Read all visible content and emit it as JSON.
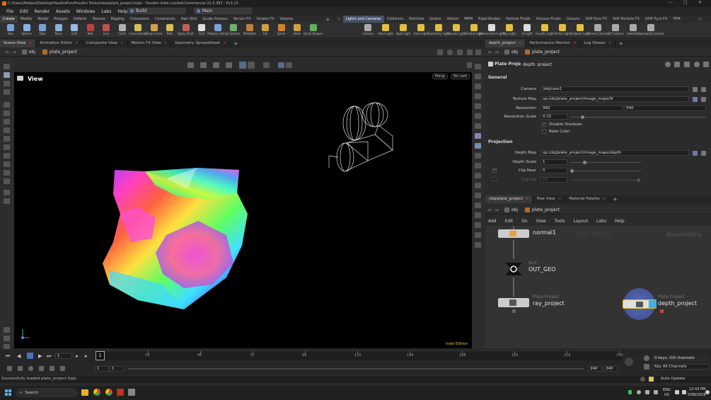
{
  "window": {
    "title": "C:/Users/Hallam/Desktop/HoudiniFun/Houdini Tricks/hdas/plate_project.hiplc - Houdini Indie Limited-Commercial 22.0.397 - Py3.13",
    "minimize": "—",
    "maximize": "□",
    "close": "✕"
  },
  "menu": {
    "items": [
      "File",
      "Edit",
      "Render",
      "Assets",
      "Windows",
      "Labs",
      "Help"
    ],
    "build_desktop": "Build",
    "main_desktop": "Main"
  },
  "shelf": {
    "tabs_left": [
      "Create",
      "Modify",
      "Model",
      "Polygon",
      "Deform",
      "Texture",
      "Rigging",
      "Characters",
      "Constraints",
      "Hair Utils",
      "Guide Process",
      "Terrain FX",
      "Simple FX",
      "Volume"
    ],
    "tabs_right": [
      "Lights and Cameras",
      "Collisions",
      "Particles",
      "Grains",
      "Vellum",
      "MPM",
      "Rigid Bodies",
      "Particle Fluids",
      "Viscous Fluids",
      "Oceans",
      "SOP Pyro FX",
      "SOP Particle FX",
      "DOP Pyro FX",
      "FEM"
    ],
    "tools_left": [
      {
        "label": "Box",
        "color": "#7aa0d8"
      },
      {
        "label": "Sphere",
        "color": "#8ab0e0"
      },
      {
        "label": "Tube",
        "color": "#7aa0d8"
      },
      {
        "label": "Torus",
        "color": "#8ab0e0"
      },
      {
        "label": "Grid",
        "color": "#9ab8e0"
      },
      {
        "label": "Null",
        "color": "#c04040"
      },
      {
        "label": "Line",
        "color": "#c05050"
      },
      {
        "label": "Circle",
        "color": "#b0b0b0"
      },
      {
        "label": "Curve Bezier",
        "color": "#d0c060"
      },
      {
        "label": "Draw Curve",
        "color": "#d0a050"
      },
      {
        "label": "Path",
        "color": "#d0c060"
      },
      {
        "label": "Spray Paint",
        "color": "#c06060"
      },
      {
        "label": "Font",
        "color": "#dddddd"
      },
      {
        "label": "Platonic Solids",
        "color": "#7aa0d8"
      },
      {
        "label": "L-System",
        "color": "#6fb06f"
      },
      {
        "label": "Metaball",
        "color": "#c08040"
      },
      {
        "label": "File",
        "color": "#d0a040"
      },
      {
        "label": "Spiral",
        "color": "#d08030"
      },
      {
        "label": "Helix",
        "color": "#d0a040"
      },
      {
        "label": "Quick Shapes",
        "color": "#60b060"
      }
    ],
    "tools_right": [
      {
        "label": "Camera",
        "color": "#aaaaaa"
      },
      {
        "label": "Point Light",
        "color": "#e0c040"
      },
      {
        "label": "Spot Light",
        "color": "#e0c040"
      },
      {
        "label": "Area Light",
        "color": "#e0c040"
      },
      {
        "label": "Geometry Light",
        "color": "#e0c040"
      },
      {
        "label": "Volume Light",
        "color": "#e0c040"
      },
      {
        "label": "Distant Light",
        "color": "#e0c040"
      },
      {
        "label": "Environment Light",
        "color": "#dddddd"
      },
      {
        "label": "Sky Light",
        "color": "#e0c040"
      },
      {
        "label": "GI Light",
        "color": "#dddddd"
      },
      {
        "label": "Caustic Light",
        "color": "#e0c040"
      },
      {
        "label": "Portal Light",
        "color": "#e0c040"
      },
      {
        "label": "Ambient Light",
        "color": "#e0c040"
      },
      {
        "label": "Stereo Camera",
        "color": "#aaaaaa"
      },
      {
        "label": "VR Camera",
        "color": "#aaaaaa"
      },
      {
        "label": "Switcher",
        "color": "#aaaaaa"
      },
      {
        "label": "Gamepad Camera",
        "color": "#aaaaaa"
      }
    ]
  },
  "left_pane": {
    "tabs": [
      "Scene View",
      "Animation Editor",
      "Composite View",
      "Motion FX View",
      "Geometry Spreadsheet"
    ],
    "path_root": "obj",
    "path_node": "plate_project",
    "viewport_title": "View",
    "persp_label": "Persp",
    "cam_label": "No cam",
    "indie_badge": "Indie Edition"
  },
  "param_pane": {
    "tabs": [
      "depth_project",
      "Performance Monitor",
      "Tree View",
      "Log Viewer"
    ],
    "path_root": "obj",
    "path_node": "plate_project",
    "node_type": "Plate Project",
    "node_name": "depth_project",
    "section_general": "General",
    "camera_label": "Camera",
    "camera_value": "/obj/cam1",
    "texture_map_label": "Texture Map",
    "texture_map_value": "op:/obj/plate_project/image_maps/N",
    "resolution_label": "Resolution",
    "resolution_x": "960",
    "resolution_y": "540",
    "resolution_scale_label": "Resolution Scale",
    "resolution_scale_value": "0.15",
    "resolution_scale_level": 0.15,
    "disable_shadows_label": "Disable Shadows",
    "disable_shadows_checked": true,
    "bake_color_label": "Bake Color",
    "bake_color_checked": false,
    "section_projection": "Projection",
    "depth_map_label": "Depth Map",
    "depth_map_value": "op:/obj/plate_project/image_maps/depth",
    "depth_scale_label": "Depth Scale",
    "depth_scale_value": "1",
    "clip_near_label": "Clip Near",
    "clip_near_value": "0",
    "clip_far_label": "Clip Far",
    "clip_far_value": "10"
  },
  "network_pane": {
    "tabs": [
      "/obj/plate_project",
      "Tree View",
      "Material Palette"
    ],
    "path_root": "obj",
    "path_node": "plate_project",
    "menu": [
      "Add",
      "Edit",
      "Go",
      "View",
      "Tools",
      "Layout",
      "Labs",
      "Help"
    ],
    "watermark_edition": "Indie Edition",
    "watermark_context": "Geometry",
    "nodes": [
      {
        "type": "",
        "name": "normal1"
      },
      {
        "type": "Null",
        "name": "OUT_GEO"
      },
      {
        "type": "Plate Project",
        "name": "ray_project"
      },
      {
        "type": "Plate Project",
        "name": "depth_project"
      }
    ]
  },
  "timeline": {
    "frame_current": "1",
    "start_frame": "1",
    "start_frame_2": "1",
    "end_frame": "240",
    "end_frame_2": "240",
    "ticks": [
      "1",
      "24",
      "48",
      "72",
      "96",
      "120",
      "144",
      "168",
      "192",
      "216",
      "240"
    ],
    "keys_label": "0 keys, 0/0 channels",
    "key_all_label": "Key All Channels",
    "auto_update": "Auto Update"
  },
  "status": {
    "message": "Successfully loaded plate_project.hiplc"
  },
  "taskbar": {
    "search_placeholder": "Search",
    "lang": "ENG",
    "region": "US",
    "time": "12:43 PM",
    "date": "5/08/2026"
  }
}
